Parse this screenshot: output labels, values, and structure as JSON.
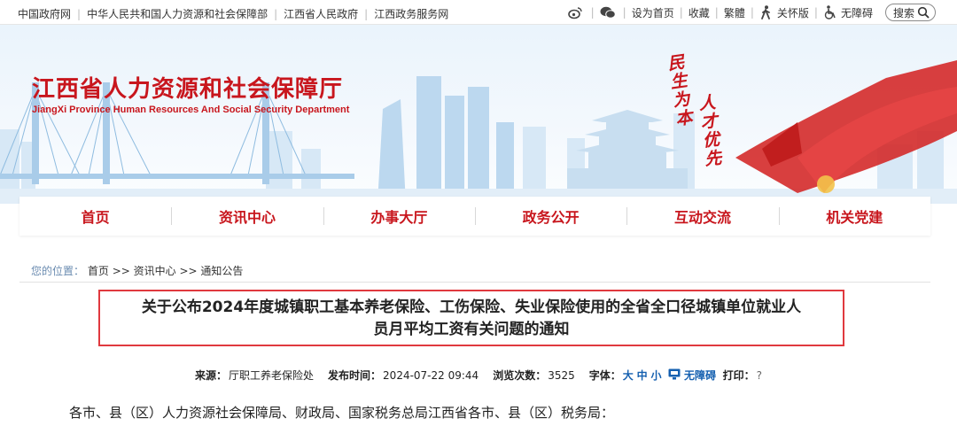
{
  "topbar": {
    "links": [
      "中国政府网",
      "中华人民共和国人力资源和社会保障部",
      "江西省人民政府",
      "江西政务服务网"
    ],
    "set_home": "设为首页",
    "bookmark": "收藏",
    "traditional": "繁體",
    "elderly": "关怀版",
    "accessibility": "无障碍",
    "search": "搜索"
  },
  "header": {
    "title": "江西省人力资源和社会保障厅",
    "subtitle": "JiangXi Province Human Resources And Social Security Department",
    "slogan_1": "民生为本",
    "slogan_2": "人才优先"
  },
  "nav": {
    "items": [
      "首页",
      "资讯中心",
      "办事大厅",
      "政务公开",
      "互动交流",
      "机关党建"
    ]
  },
  "breadcrumb": {
    "label": "您的位置：",
    "path": [
      "首页",
      "资讯中心",
      "通知公告"
    ]
  },
  "article": {
    "title_line1": "关于公布2024年度城镇职工基本养老保险、工伤保险、失业保险使用的全省全口径城镇单位就业人",
    "title_line2": "员月平均工资有关问题的通知",
    "source_label": "来源：",
    "source": "厅职工养老保险处",
    "time_label": "发布时间：",
    "time": "2024-07-22 09:44",
    "views_label": "浏览次数：",
    "views": "3525",
    "font_label": "字体：",
    "font_large": "大",
    "font_medium": "中",
    "font_small": "小",
    "accessibility": "无障碍",
    "print_label": "打印：",
    "print_value": "?",
    "first_paragraph": "各市、县（区）人力资源社会保障局、财政局、国家税务总局江西省各市、县（区）税务局："
  },
  "colors": {
    "brand_red": "#c8161d",
    "title_border": "#e0393e",
    "link_blue": "#1560b0"
  }
}
